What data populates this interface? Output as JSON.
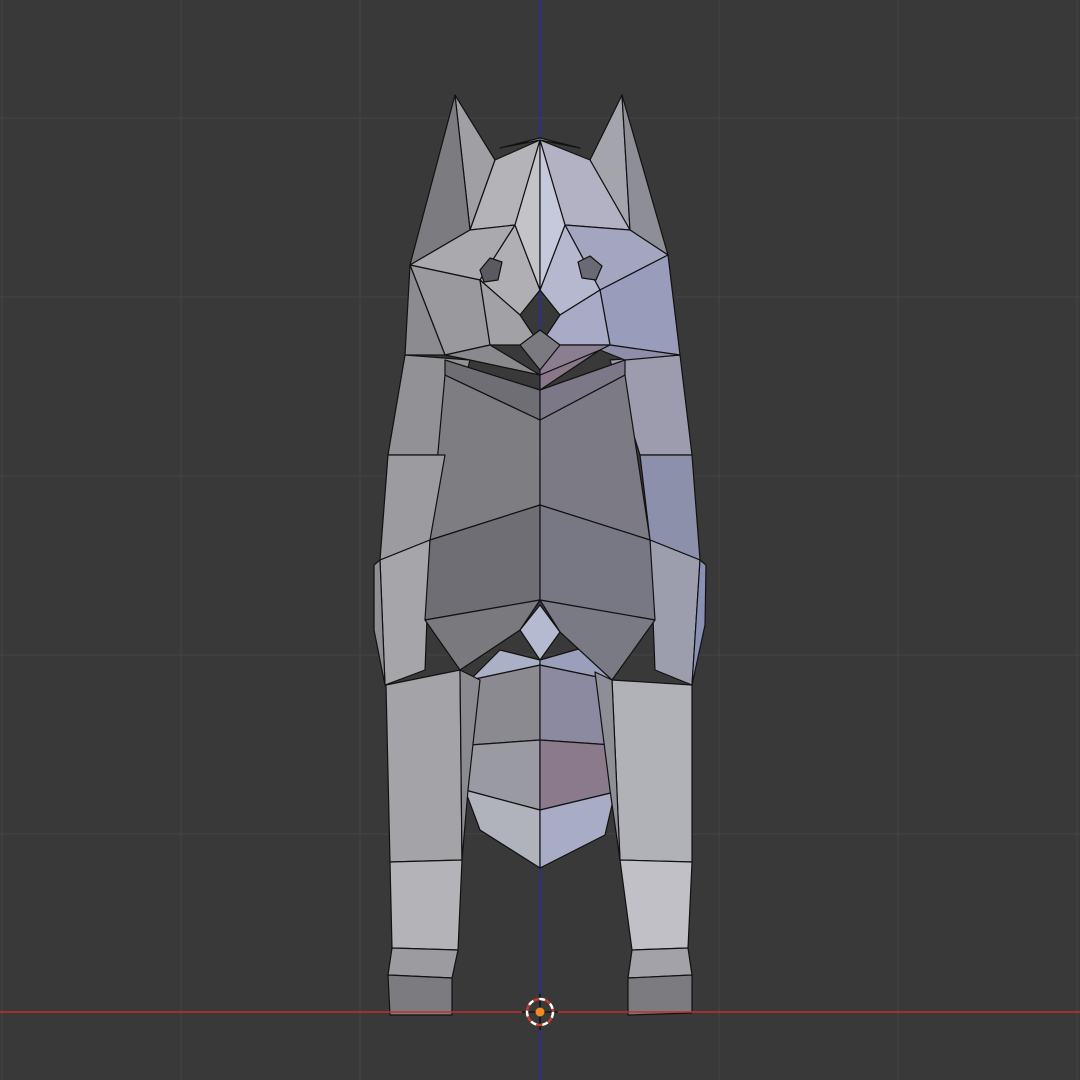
{
  "viewport": {
    "background_color": "#393939",
    "grid_color": "#454545",
    "x_axis_color": "#c0302c",
    "y_axis_color": "#2a2aa8",
    "wire_color": "#111111",
    "object": "dog-lowpoly-mesh",
    "view": "front-orthographic",
    "shading": "solid-with-wireframe"
  },
  "cursor": {
    "icon": "3d-cursor-icon",
    "ring_colors": [
      "#ffffff",
      "#c83a2c"
    ],
    "center_color": "#f08a22"
  }
}
